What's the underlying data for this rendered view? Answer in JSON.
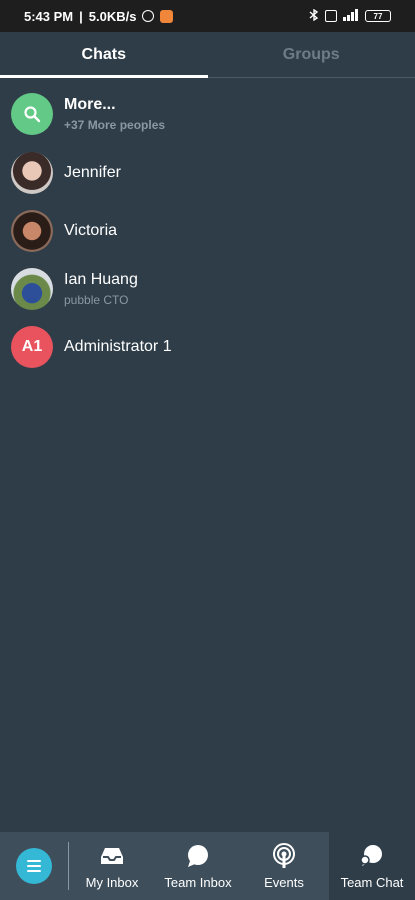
{
  "status_bar": {
    "time": "5:43 PM",
    "separator": "|",
    "speed": "5.0KB/s",
    "battery": "77"
  },
  "tabs": [
    {
      "label": "Chats",
      "active": true
    },
    {
      "label": "Groups",
      "active": false
    }
  ],
  "chats": {
    "more": {
      "name": "More...",
      "subtitle": "+37 More peoples",
      "icon": "search-icon"
    },
    "items": [
      {
        "name": "Jennifer",
        "subtitle": ""
      },
      {
        "name": "Victoria",
        "subtitle": ""
      },
      {
        "name": "Ian Huang",
        "subtitle": "pubble CTO"
      },
      {
        "name": "Administrator 1",
        "subtitle": "",
        "initials": "A1"
      }
    ]
  },
  "bottom_nav": {
    "menu_icon": "hamburger-icon",
    "items": [
      {
        "label": "My Inbox",
        "icon": "inbox-icon"
      },
      {
        "label": "Team Inbox",
        "icon": "speech-bubble-icon"
      },
      {
        "label": "Events",
        "icon": "broadcast-icon"
      },
      {
        "label": "Team Chat",
        "icon": "chat-bubbles-icon"
      }
    ]
  },
  "colors": {
    "background": "#2e3d48",
    "search_avatar": "#63c987",
    "initials_avatar": "#e8535e",
    "menu_button": "#35b8d6",
    "nav_bar": "#3e4f5b"
  }
}
